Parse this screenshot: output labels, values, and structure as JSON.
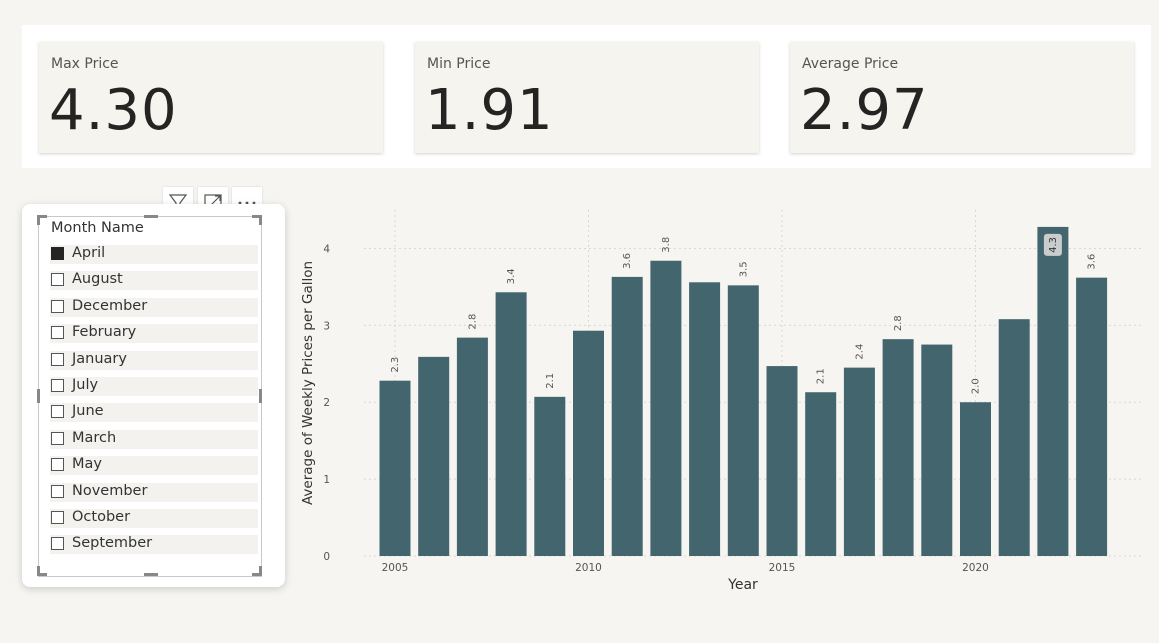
{
  "kpis": [
    {
      "title": "Max Price",
      "value": "4.30"
    },
    {
      "title": "Min Price",
      "value": "1.91"
    },
    {
      "title": "Average Price",
      "value": "2.97"
    }
  ],
  "slicer": {
    "header": "Month Name",
    "items": [
      {
        "label": "April",
        "checked": true
      },
      {
        "label": "August",
        "checked": false
      },
      {
        "label": "December",
        "checked": false
      },
      {
        "label": "February",
        "checked": false
      },
      {
        "label": "January",
        "checked": false
      },
      {
        "label": "July",
        "checked": false
      },
      {
        "label": "June",
        "checked": false
      },
      {
        "label": "March",
        "checked": false
      },
      {
        "label": "May",
        "checked": false
      },
      {
        "label": "November",
        "checked": false
      },
      {
        "label": "October",
        "checked": false
      },
      {
        "label": "September",
        "checked": false
      }
    ],
    "tools": [
      "filter-icon",
      "focus-mode-icon",
      "more-options-icon"
    ]
  },
  "colors": {
    "bar": "#43666e",
    "background": "#f6f5f1"
  },
  "chart_data": {
    "type": "bar",
    "xlabel": "Year",
    "ylabel": "Average of Weekly Prices per Gallon",
    "ylim": [
      0,
      4.5
    ],
    "yticks": [
      0,
      1,
      2,
      3,
      4
    ],
    "xticks": [
      2005,
      2010,
      2015,
      2020
    ],
    "grid": true,
    "categories": [
      2005,
      2006,
      2007,
      2008,
      2009,
      2010,
      2011,
      2012,
      2013,
      2014,
      2015,
      2016,
      2017,
      2018,
      2019,
      2020,
      2021,
      2022,
      2023
    ],
    "values": [
      2.28,
      2.59,
      2.84,
      3.43,
      2.07,
      2.93,
      3.63,
      3.84,
      3.56,
      3.52,
      2.47,
      2.13,
      2.45,
      2.82,
      2.75,
      2.0,
      3.08,
      4.28,
      3.62
    ],
    "data_labels": [
      "2.3",
      "",
      "2.8",
      "3.4",
      "2.1",
      "",
      "3.6",
      "3.8",
      "",
      "3.5",
      "",
      "2.1",
      "2.4",
      "2.8",
      "",
      "2.0",
      "",
      "4.3",
      "3.6"
    ],
    "highlighted_label_index": 17
  }
}
